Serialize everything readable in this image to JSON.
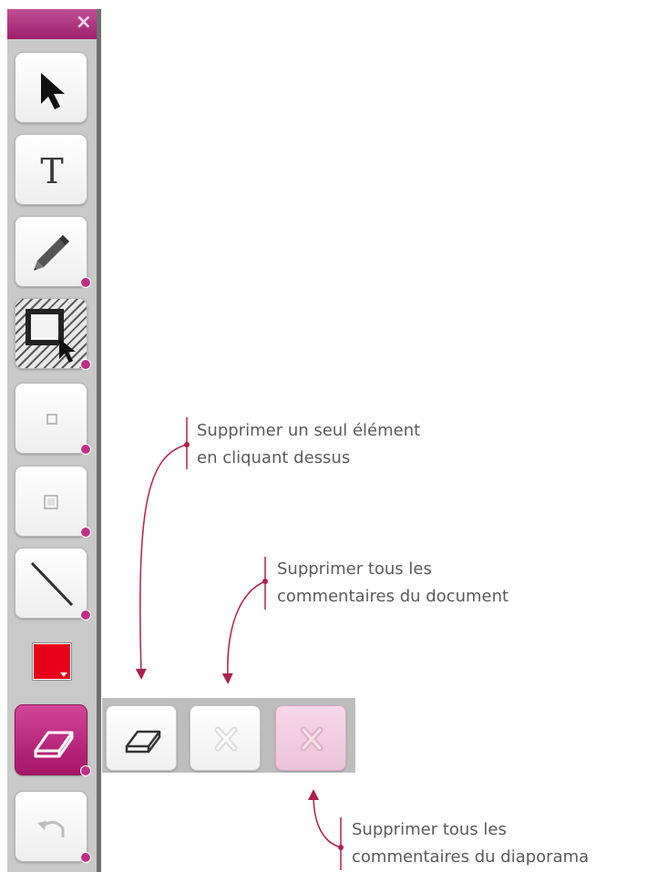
{
  "palette": {
    "close_glyph": "×",
    "tools": [
      {
        "name": "select-arrow-icon"
      },
      {
        "name": "text-tool-icon",
        "glyph": "T"
      },
      {
        "name": "pencil-icon"
      },
      {
        "name": "area-select-icon"
      },
      {
        "name": "shape-small-icon"
      },
      {
        "name": "shape-medium-icon"
      },
      {
        "name": "line-icon"
      },
      {
        "name": "color-picker",
        "color": "#e8001b"
      },
      {
        "name": "eraser-icon",
        "active": true
      },
      {
        "name": "undo-icon"
      }
    ],
    "accent_color": "#b8226f"
  },
  "eraser_panel": {
    "options": [
      {
        "name": "eraser-single-icon"
      },
      {
        "name": "clear-document-icon"
      },
      {
        "name": "clear-slideshow-icon"
      }
    ]
  },
  "annotations": {
    "single": [
      "Supprimer un seul élément",
      "en cliquant dessus"
    ],
    "document": [
      "Supprimer tous les",
      "commentaires du document"
    ],
    "slideshow": [
      "Supprimer tous les",
      "commentaires du diaporama"
    ],
    "line_color": "#b01f4e"
  }
}
